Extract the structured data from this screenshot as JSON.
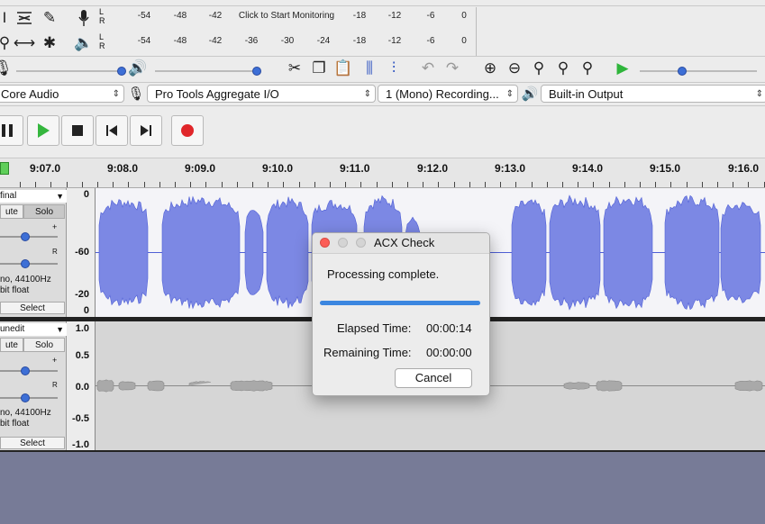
{
  "meters": {
    "record_scale": [
      "-54",
      "-48",
      "-42",
      "-18",
      "-12",
      "-6",
      "0"
    ],
    "record_prompt": "Click to Start Monitoring",
    "play_scale": [
      "-54",
      "-48",
      "-42",
      "-36",
      "-30",
      "-24",
      "-18",
      "-12",
      "-6",
      "0"
    ],
    "lr": [
      "L",
      "R"
    ]
  },
  "devices": {
    "host": "Core Audio",
    "input_device": "Pro Tools Aggregate I/O",
    "channels": "1 (Mono) Recording...",
    "output_device": "Built-in Output"
  },
  "timeline": {
    "labels": [
      "9:07.0",
      "9:08.0",
      "9:09.0",
      "9:10.0",
      "9:11.0",
      "9:12.0",
      "9:13.0",
      "9:14.0",
      "9:15.0",
      "9:16.0"
    ]
  },
  "tracks": [
    {
      "name": "final",
      "mute": "ute",
      "solo": "Solo",
      "info_line1": "no, 44100Hz",
      "info_line2": "bit float",
      "select": "Select",
      "pan_plus": "+",
      "pan_r": "R",
      "scale": [
        "0",
        "-60",
        "-20",
        "0"
      ]
    },
    {
      "name": "unedit",
      "mute": "ute",
      "solo": "Solo",
      "info_line1": "no, 44100Hz",
      "info_line2": "bit float",
      "select": "Select",
      "pan_plus": "+",
      "pan_r": "R",
      "scale": [
        "1.0",
        "0.5",
        "0.0",
        "-0.5",
        "-1.0"
      ]
    }
  ],
  "dialog": {
    "title": "ACX Check",
    "status": "Processing complete.",
    "progress": 1.0,
    "elapsed_label": "Elapsed Time:",
    "elapsed_value": "00:00:14",
    "remaining_label": "Remaining Time:",
    "remaining_value": "00:00:00",
    "cancel": "Cancel"
  },
  "colors": {
    "waveform": "#4f5fd6",
    "waveform_light": "#7c88e4",
    "progress": "#3b86e0",
    "background": "#777b97"
  }
}
